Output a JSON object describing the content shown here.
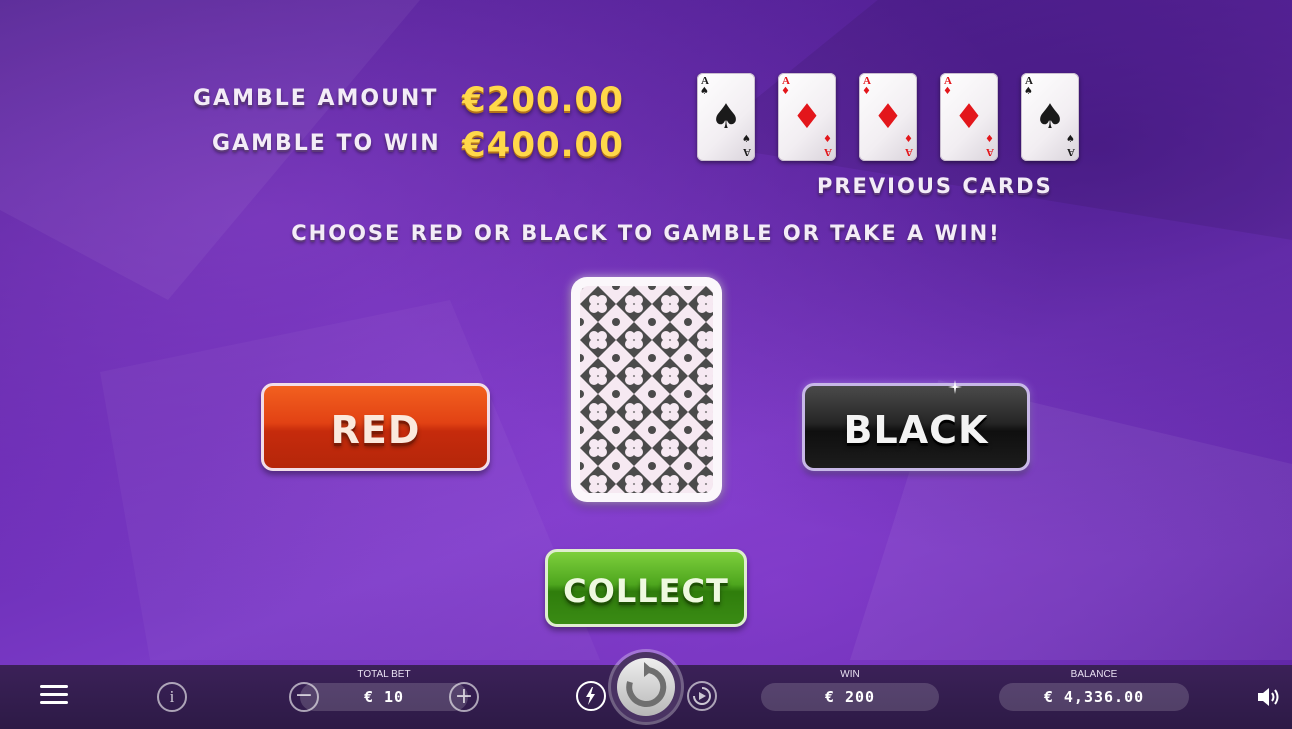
{
  "gamble": {
    "amount_label": "GAMBLE AMOUNT",
    "amount_value": "€200.00",
    "to_win_label": "GAMBLE TO WIN",
    "to_win_value": "€400.00"
  },
  "previous_cards": {
    "title": "PREVIOUS CARDS",
    "cards": [
      {
        "rank": "A",
        "suit": "♠",
        "color": "black"
      },
      {
        "rank": "A",
        "suit": "♦",
        "color": "red"
      },
      {
        "rank": "A",
        "suit": "♦",
        "color": "red"
      },
      {
        "rank": "A",
        "suit": "♦",
        "color": "red"
      },
      {
        "rank": "A",
        "suit": "♠",
        "color": "black"
      }
    ]
  },
  "instruction": "CHOOSE RED OR BLACK TO GAMBLE OR TAKE A WIN!",
  "buttons": {
    "red": "RED",
    "black": "BLACK",
    "collect": "COLLECT"
  },
  "bottom_bar": {
    "total_bet_label": "TOTAL BET",
    "total_bet_value": "€ 10",
    "win_label": "WIN",
    "win_value": "€ 200",
    "balance_label": "BALANCE",
    "balance_value": "€ 4,336.00"
  },
  "icons": {
    "menu": "hamburger-menu-icon",
    "info": "info-icon",
    "minus": "minus-icon",
    "plus": "plus-icon",
    "turbo": "lightning-icon",
    "spin": "spin-icon",
    "autoplay": "autoplay-icon",
    "sound": "speaker-icon"
  },
  "colors": {
    "red_button": "#e24214",
    "black_button": "#1c1c1c",
    "collect_button": "#4ea61e",
    "gold_text": "#ffd84a",
    "background": "#6a2cb4"
  }
}
